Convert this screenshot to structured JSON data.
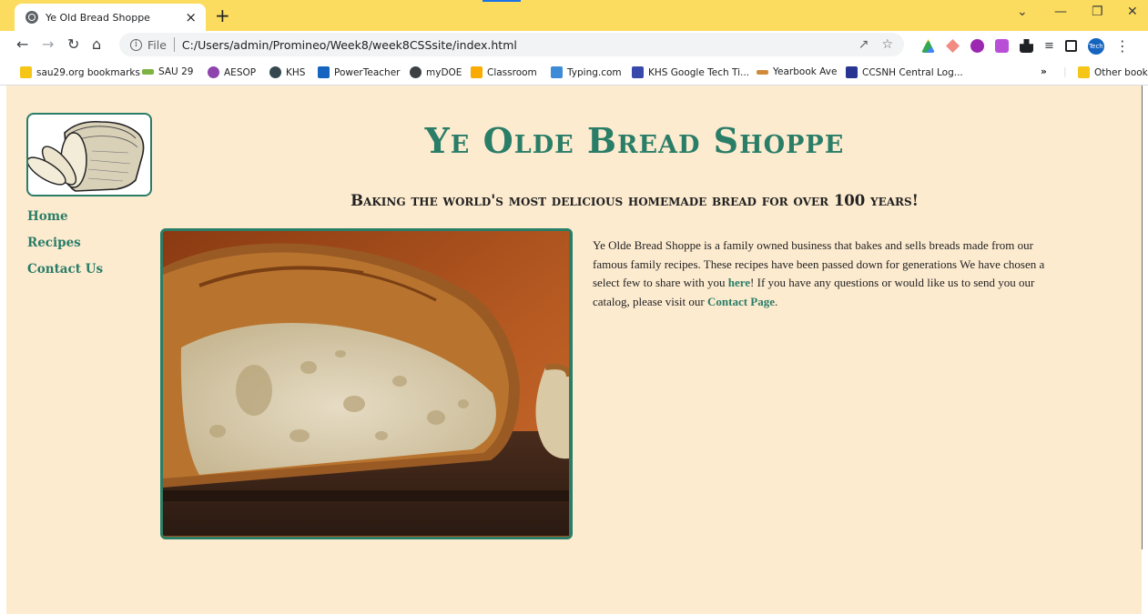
{
  "browser": {
    "tab_title": "Ye Old Bread Shoppe",
    "tab_close": "×",
    "new_tab": "+",
    "address": {
      "scheme_label": "File",
      "url": "C:/Users/admin/Promineo/Week8/week8CSSsite/index.html"
    },
    "profile_initials": "Tech",
    "bookmarks": [
      {
        "label": "sau29.org bookmarks",
        "icon": "folder-icon",
        "color": "#f5c518"
      },
      {
        "label": "SAU 29",
        "icon": "sau29-icon",
        "color": "#7cb342"
      },
      {
        "label": "AESOP",
        "icon": "aesop-icon",
        "color": "#8e44ad"
      },
      {
        "label": "KHS",
        "icon": "khs-icon",
        "color": "#37474f"
      },
      {
        "label": "PowerTeacher",
        "icon": "sis-icon",
        "color": "#1565c0"
      },
      {
        "label": "myDOE",
        "icon": "globe-icon",
        "color": "#3c4043"
      },
      {
        "label": "Classroom",
        "icon": "classroom-icon",
        "color": "#f9ab00"
      },
      {
        "label": "Typing.com",
        "icon": "typing-icon",
        "color": "#3d8bd6"
      },
      {
        "label": "KHS Google Tech Ti...",
        "icon": "forms-icon",
        "color": "#3949ab"
      },
      {
        "label": "Yearbook Ave",
        "icon": "yearbook-icon",
        "color": "#d08b3a"
      },
      {
        "label": "CCSNH Central Log...",
        "icon": "ccsnh-icon",
        "color": "#283593"
      }
    ],
    "more_bookmarks": "»",
    "other_bookmarks": "Other bookmarks"
  },
  "site": {
    "title": "Ye Olde Bread Shoppe",
    "tagline": "Baking the world's most delicious homemade bread for over 100 years!",
    "nav": [
      "Home",
      "Recipes",
      "Contact Us"
    ],
    "intro": {
      "part1": "Ye Olde Bread Shoppe is a family owned business that bakes and sells breads made from our famous family recipes. These recipes have been passed down for generations We have chosen a select few to share with you ",
      "link1": "here",
      "part2": "! If you have any questions or would like us to send you our catalog, please visit our ",
      "link2": "Contact Page",
      "part3": "."
    },
    "accent_color": "#2a7d67",
    "background_color": "#fdebd0"
  }
}
